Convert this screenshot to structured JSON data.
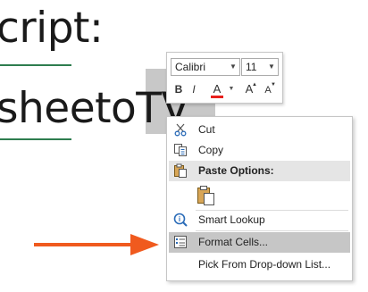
{
  "background": {
    "line1": "cript:",
    "line2": "sheetoTV"
  },
  "mini_toolbar": {
    "font_name": "Calibri",
    "font_size": "11",
    "bold": "B",
    "italic": "I",
    "font_color": "A",
    "grow_font": "A",
    "shrink_font": "A",
    "font_color_accent": "#e8201c"
  },
  "context_menu": {
    "cut": "Cut",
    "copy": "Copy",
    "paste_options": "Paste Options:",
    "smart_lookup": "Smart Lookup",
    "format_cells": "Format Cells...",
    "pick_from_list": "Pick From Drop-down List..."
  },
  "colors": {
    "arrow": "#f05a1e",
    "highlight": "#c6c6c6",
    "underline": "#2e7d4f"
  },
  "icons": [
    "scissors-icon",
    "copy-icon",
    "paste-options-icon",
    "paste-icon",
    "smart-lookup-icon",
    "format-cells-icon"
  ]
}
